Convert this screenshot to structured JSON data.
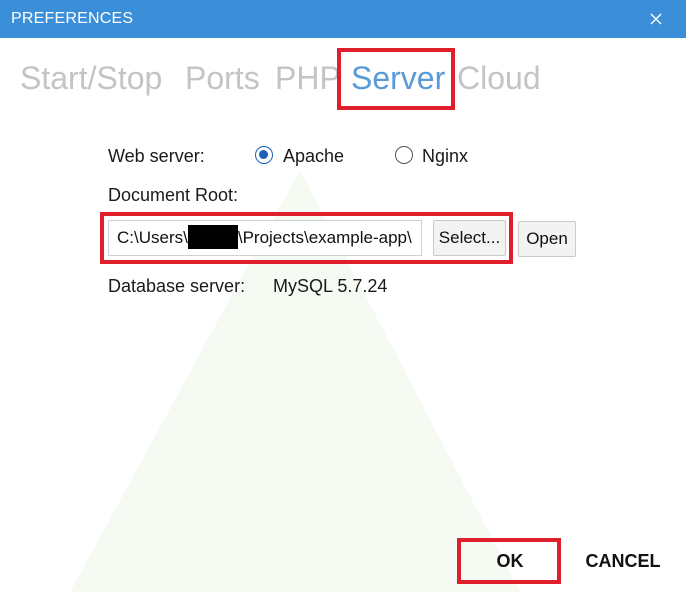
{
  "window": {
    "title": "PREFERENCES"
  },
  "tabs": [
    {
      "label": "Start/Stop",
      "active": false
    },
    {
      "label": "Ports",
      "active": false
    },
    {
      "label": "PHP",
      "active": false
    },
    {
      "label": "Server",
      "active": true
    },
    {
      "label": "Cloud",
      "active": false
    }
  ],
  "form": {
    "web_server_label": "Web server:",
    "web_server_options": [
      {
        "label": "Apache",
        "selected": true
      },
      {
        "label": "Nginx",
        "selected": false
      }
    ],
    "document_root_label": "Document Root:",
    "document_root_value_prefix": "C:\\Users\\",
    "document_root_value_suffix": "\\Projects\\example-app\\",
    "select_button": "Select...",
    "open_button": "Open",
    "database_label": "Database server:",
    "database_value": "MySQL 5.7.24"
  },
  "footer": {
    "ok_label": "OK",
    "cancel_label": "CANCEL"
  },
  "colors": {
    "titlebar": "#3b8fd8",
    "active_tab": "#5a9ad8",
    "inactive_tab": "#c4c4c4",
    "highlight_border": "#e01f2d",
    "radio_selected": "#1e5fb8"
  }
}
